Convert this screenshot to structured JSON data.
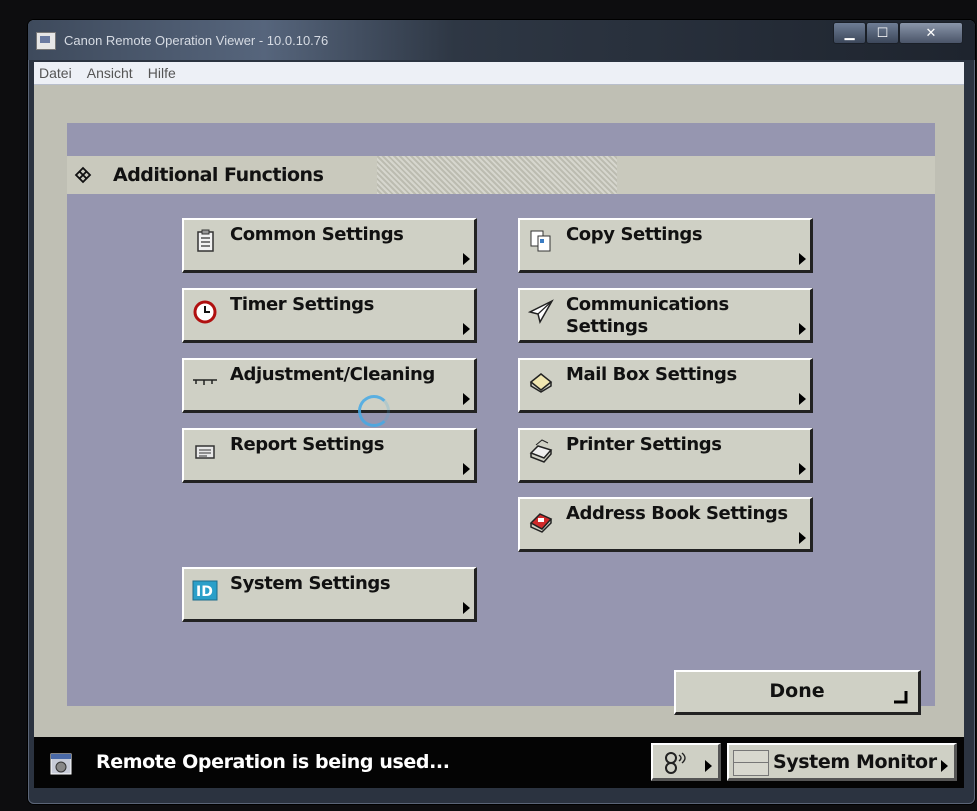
{
  "window": {
    "title": "Canon Remote Operation Viewer - 10.0.10.76"
  },
  "menubar": {
    "items": [
      "Datei",
      "Ansicht",
      "Hilfe"
    ]
  },
  "panel": {
    "title": "Additional Functions",
    "buttons": {
      "common": "Common Settings",
      "timer": "Timer Settings",
      "adjustment": "Adjustment/Cleaning",
      "report": "Report Settings",
      "system": "System Settings",
      "copy": "Copy Settings",
      "communications_line1": "Communications",
      "communications_line2": "Settings",
      "mailbox": "Mail Box Settings",
      "printer": "Printer Settings",
      "addressbook": "Address Book Settings"
    },
    "done_label": "Done"
  },
  "statusbar": {
    "message": "Remote Operation is being used...",
    "system_monitor_label": "System Monitor"
  },
  "colors": {
    "panel": "#9696b0",
    "button": "#cfd0c5",
    "client": "#bfbfb4",
    "statusbar": "#040404"
  }
}
